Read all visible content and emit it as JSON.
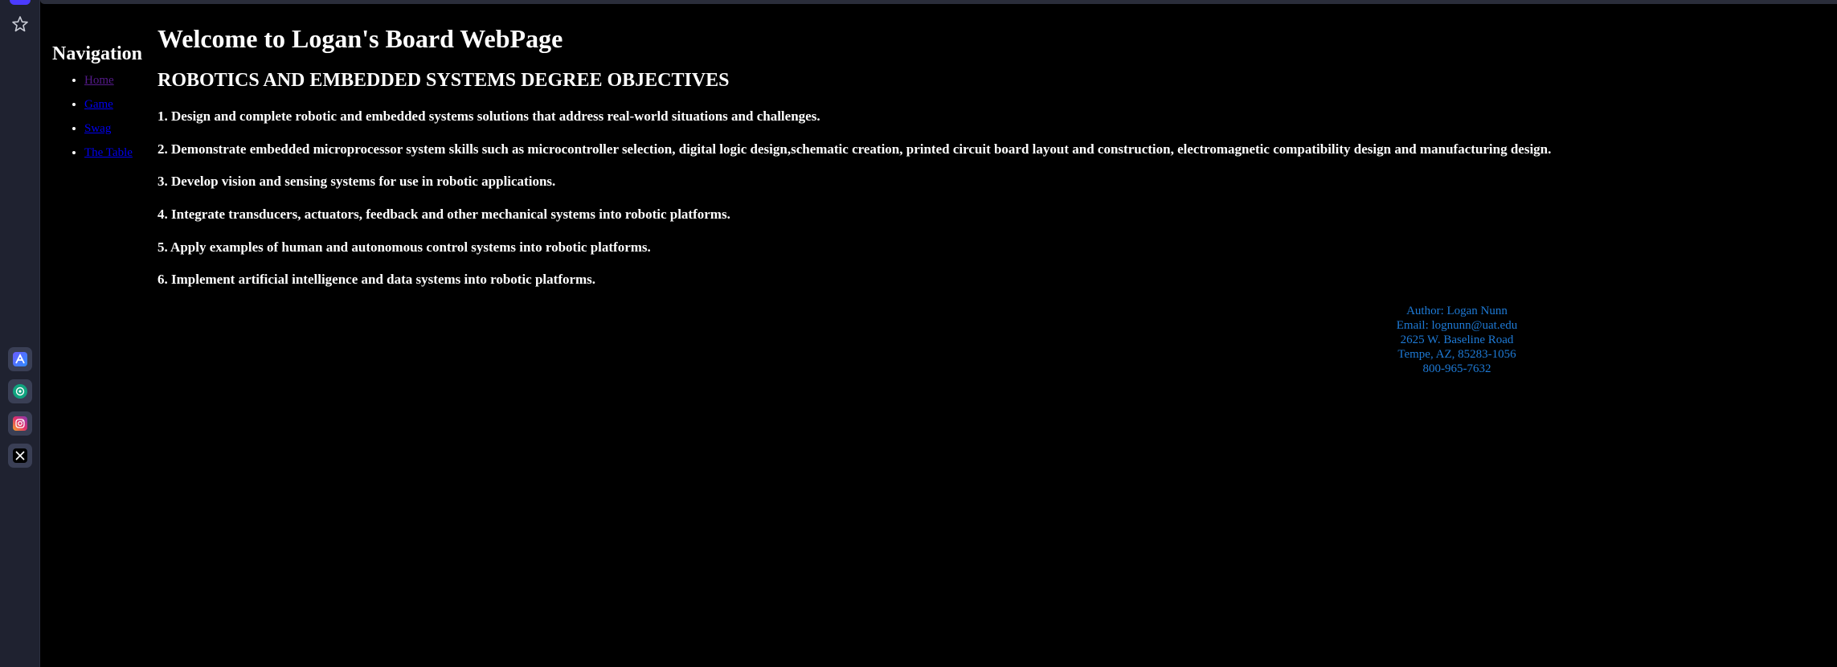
{
  "colors": {
    "background": "#000000",
    "side_rail": "#1f2230",
    "link": "#0000ee",
    "visited_link": "#551a8b",
    "footer_text": "#1e7ad6"
  },
  "side_rail": {
    "icons": [
      "star-icon",
      "app-a-icon",
      "openai-icon",
      "instagram-icon",
      "x-icon"
    ]
  },
  "nav": {
    "heading": "Navigation",
    "links": [
      {
        "label": "Home",
        "visited": true
      },
      {
        "label": "Game",
        "visited": false
      },
      {
        "label": "Swag",
        "visited": false
      },
      {
        "label": "The Table",
        "visited": false
      }
    ]
  },
  "main": {
    "title": "Welcome to Logan's Board WebPage",
    "subtitle": "ROBOTICS AND EMBEDDED SYSTEMS DEGREE OBJECTIVES",
    "objectives": [
      "1. Design and complete robotic and embedded systems solutions that address real-world situations and challenges.",
      "2. Demonstrate embedded microprocessor system skills such as microcontroller selection, digital logic design,schematic creation, printed circuit board layout and construction, electromagnetic compatibility design and manufacturing design.",
      "3. Develop vision and sensing systems for use in robotic applications.",
      "4. Integrate transducers, actuators, feedback and other mechanical systems into robotic platforms.",
      "5. Apply examples of human and autonomous control systems into robotic platforms.",
      "6. Implement artificial intelligence and data systems into robotic platforms."
    ]
  },
  "footer": {
    "author": "Author: Logan Nunn",
    "email": "Email: lognunn@uat.edu",
    "street": "2625 W. Baseline Road",
    "city": "Tempe, AZ, 85283-1056",
    "phone": "800-965-7632"
  }
}
